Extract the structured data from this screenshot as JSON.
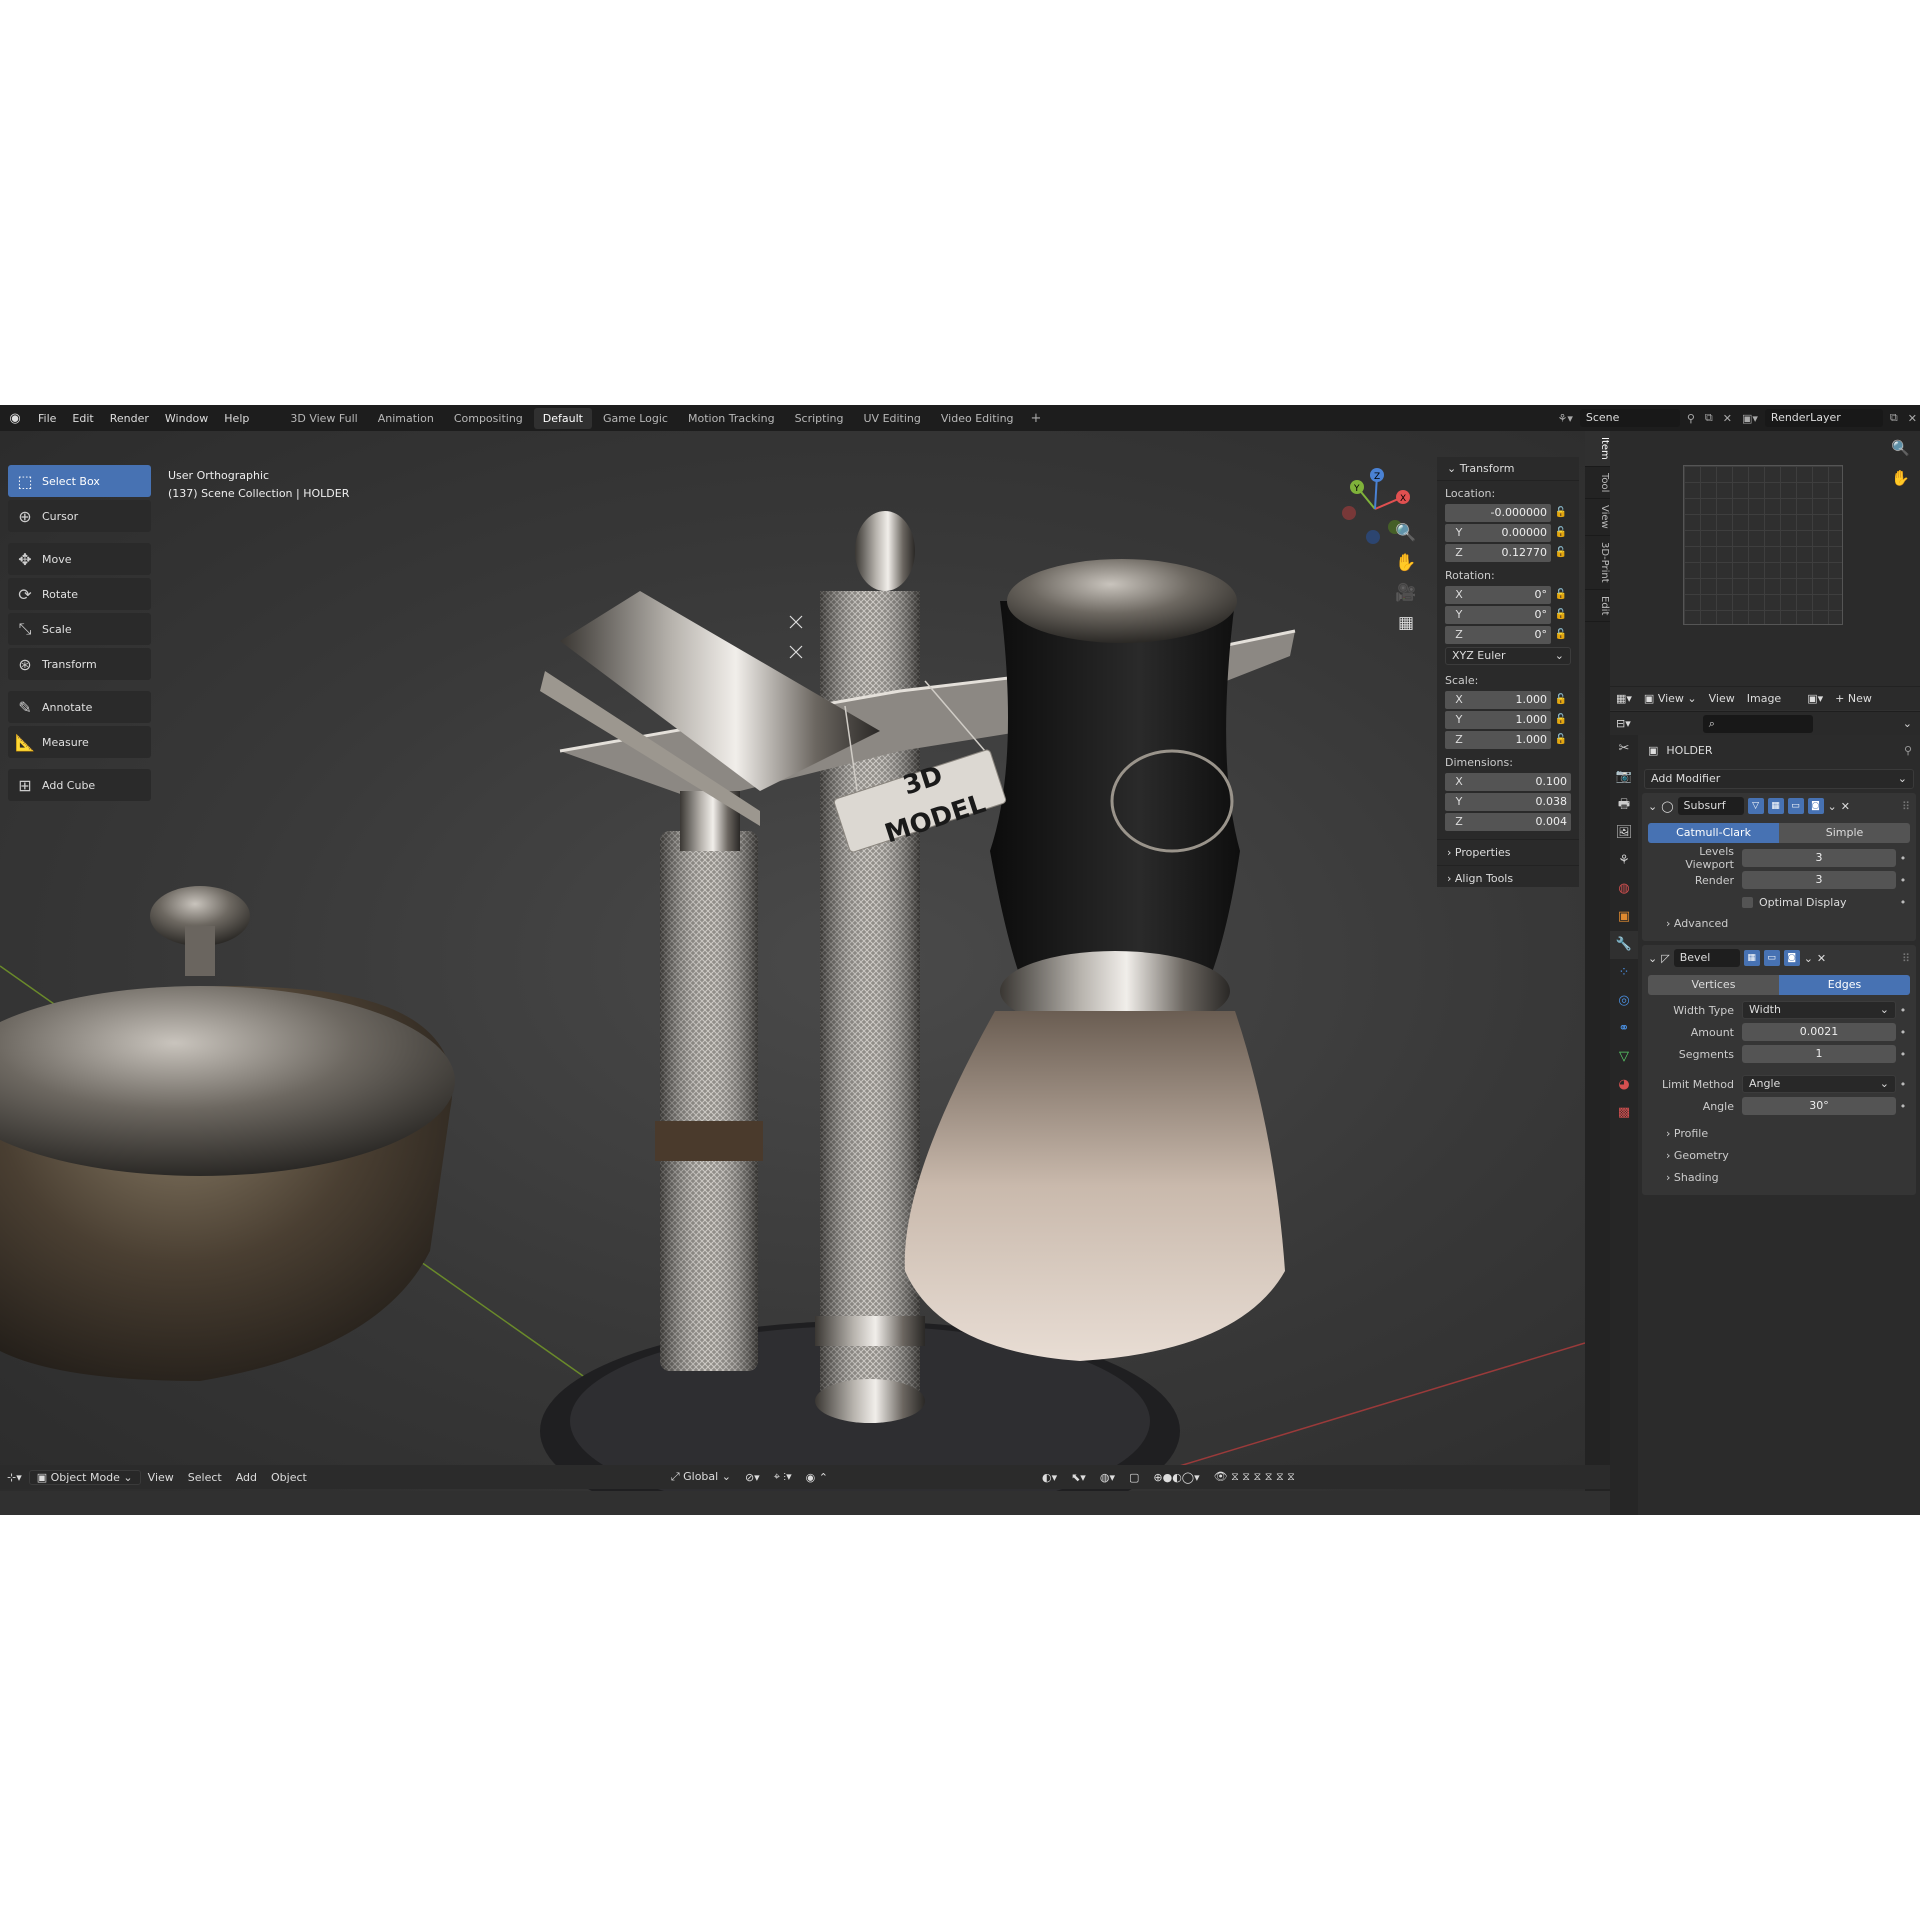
{
  "topbar": {
    "menus": [
      "File",
      "Edit",
      "Render",
      "Window",
      "Help"
    ],
    "workspaces": [
      "3D View Full",
      "Animation",
      "Compositing",
      "Default",
      "Game Logic",
      "Motion Tracking",
      "Scripting",
      "UV Editing",
      "Video Editing"
    ],
    "active_workspace": "Default",
    "scene": "Scene",
    "render_layer": "RenderLayer"
  },
  "toolbar": {
    "tools": [
      {
        "label": "Select Box",
        "icon": "select-box-icon",
        "active": true
      },
      {
        "label": "Cursor",
        "icon": "cursor-icon"
      },
      {
        "label": "Move",
        "icon": "move-icon"
      },
      {
        "label": "Rotate",
        "icon": "rotate-icon"
      },
      {
        "label": "Scale",
        "icon": "scale-icon"
      },
      {
        "label": "Transform",
        "icon": "transform-icon"
      },
      {
        "label": "Annotate",
        "icon": "annotate-icon"
      },
      {
        "label": "Measure",
        "icon": "measure-icon"
      },
      {
        "label": "Add Cube",
        "icon": "add-cube-icon"
      }
    ]
  },
  "viewport": {
    "view_name": "User Orthographic",
    "collection": "(137) Scene Collection | HOLDER",
    "tag_text": "3D MODEL",
    "header": {
      "mode": "Object Mode",
      "menus": [
        "View",
        "Select",
        "Add",
        "Object"
      ],
      "orientation": "Global"
    },
    "gizmo": {
      "x": "X",
      "y": "Y",
      "z": "Z"
    }
  },
  "npanel": {
    "title": "Transform",
    "location_label": "Location:",
    "location": {
      "x": "-0.000000",
      "y": "0.00000",
      "z": "0.12770"
    },
    "rotation_label": "Rotation:",
    "rotation": {
      "x": "0°",
      "y": "0°",
      "z": "0°"
    },
    "rotation_mode": "XYZ Euler",
    "scale_label": "Scale:",
    "scale": {
      "x": "1.000",
      "y": "1.000",
      "z": "1.000"
    },
    "dimensions_label": "Dimensions:",
    "dimensions": {
      "x": "0.100",
      "y": "0.038",
      "z": "0.004"
    },
    "properties": "Properties",
    "align_tools": "Align Tools",
    "tabs": [
      "Item",
      "Tool",
      "View",
      "3D-Print",
      "Edit"
    ]
  },
  "image_editor": {
    "menus": [
      "View",
      "View",
      "Image"
    ],
    "new_label": "New"
  },
  "properties": {
    "object_name": "HOLDER",
    "add_modifier": "Add Modifier",
    "subsurf": {
      "name": "Subsurf",
      "modes": [
        "Catmull-Clark",
        "Simple"
      ],
      "levels_viewport_label": "Levels Viewport",
      "levels_viewport": "3",
      "render_label": "Render",
      "render": "3",
      "optimal_display": "Optimal Display",
      "advanced": "Advanced"
    },
    "bevel": {
      "name": "Bevel",
      "modes": [
        "Vertices",
        "Edges"
      ],
      "width_type_label": "Width Type",
      "width_type": "Width",
      "amount_label": "Amount",
      "amount": "0.0021",
      "segments_label": "Segments",
      "segments": "1",
      "limit_method_label": "Limit Method",
      "limit_method": "Angle",
      "angle_label": "Angle",
      "angle": "30°",
      "profile": "Profile",
      "geometry": "Geometry",
      "shading": "Shading"
    }
  }
}
